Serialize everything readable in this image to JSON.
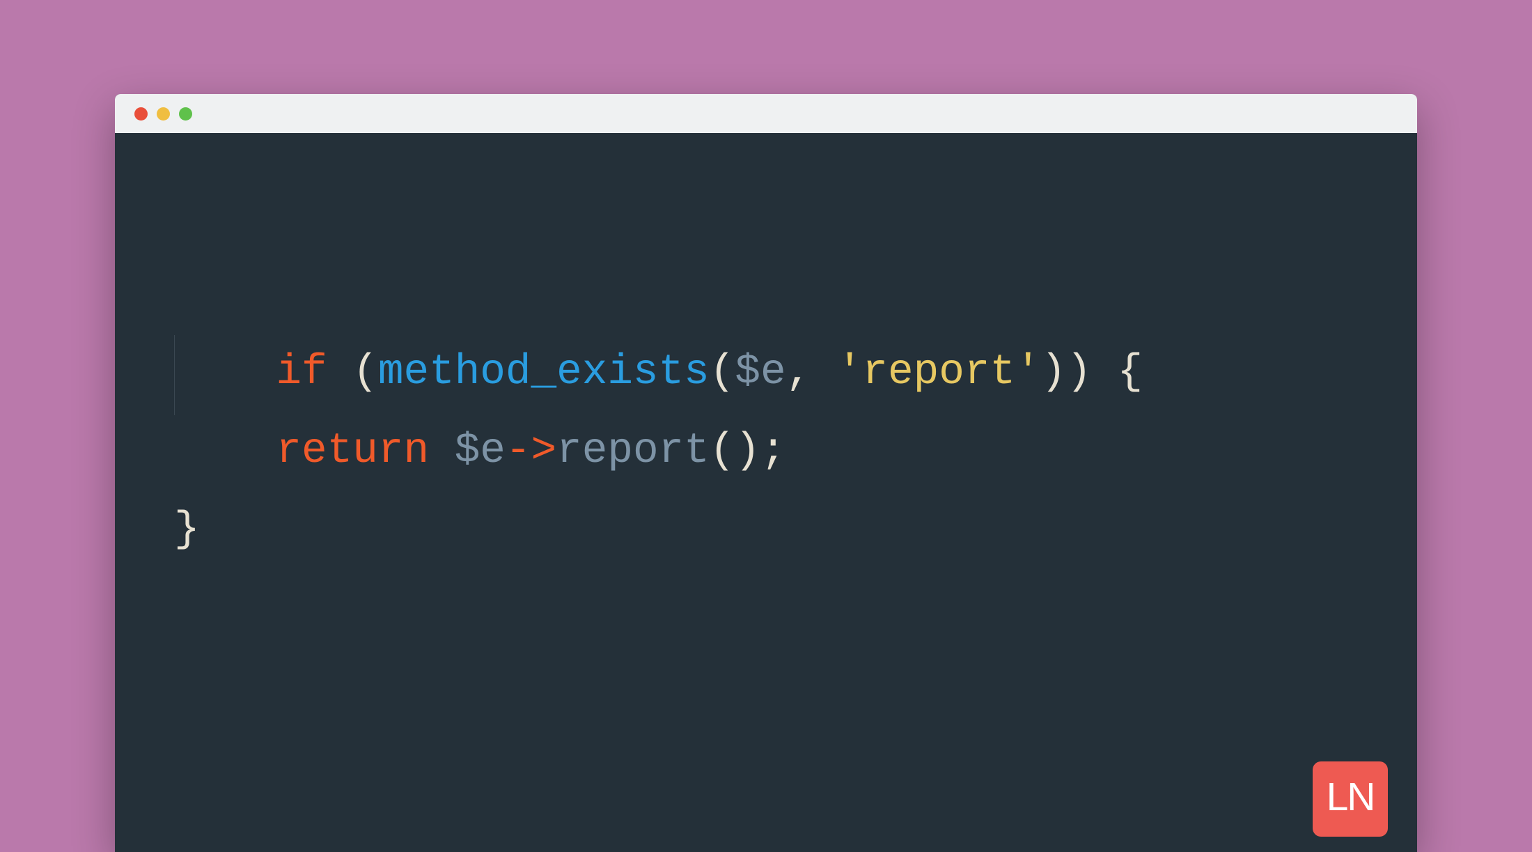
{
  "code": {
    "line1": {
      "keyword": "if",
      "space1": " ",
      "paren_open": "(",
      "func": "method_exists",
      "args_open": "(",
      "var": "$e",
      "comma": ", ",
      "string": "'report'",
      "args_close": ")",
      "paren_close": ")",
      "space2": " ",
      "brace_open": "{"
    },
    "line2": {
      "indent": "    ",
      "keyword": "return",
      "space1": " ",
      "var": "$e",
      "arrow": "->",
      "method": "report",
      "call": "();"
    },
    "line3": {
      "brace_close": "}"
    }
  },
  "logo": {
    "text": "LN"
  }
}
